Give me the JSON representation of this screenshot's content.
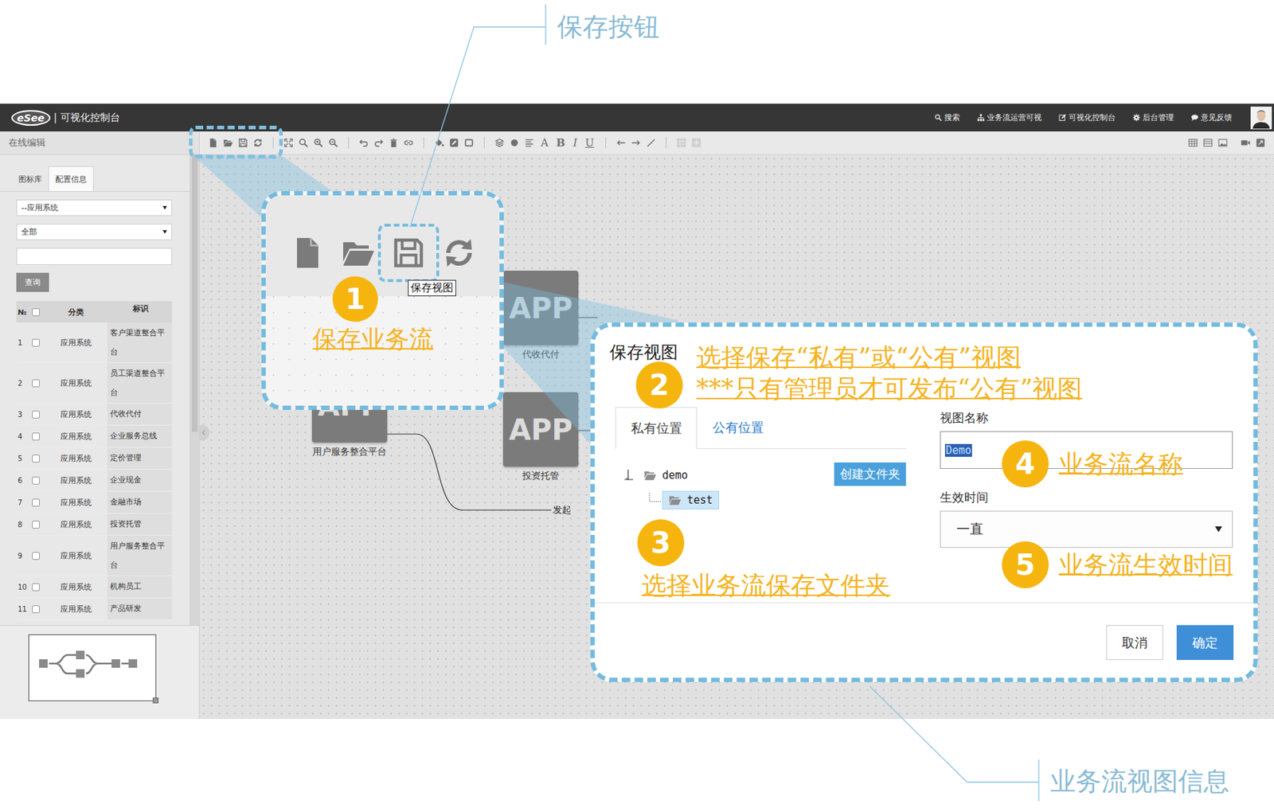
{
  "annotations": {
    "save_button_label": "保存按钮",
    "view_info_label": "业务流视图信息"
  },
  "topbar": {
    "logo": "eSee",
    "title": "| 可视化控制台",
    "nav": [
      {
        "label": "搜索"
      },
      {
        "label": "业务流运营可视"
      },
      {
        "label": "可视化控制台"
      },
      {
        "label": "后台管理"
      },
      {
        "label": "意见反馈"
      }
    ]
  },
  "left_panel": {
    "header": "在线编辑",
    "tabs": [
      {
        "label": "图标库",
        "selected": false
      },
      {
        "label": "配置信息",
        "selected": true
      }
    ],
    "filters": [
      "--应用系统",
      "全部"
    ],
    "search_input": "",
    "query_button": "查询",
    "table": {
      "columns": [
        "№",
        "分类",
        "标识"
      ],
      "header_checked": false,
      "rows": [
        {
          "no": "1",
          "category": "应用系统",
          "name": "客户渠道整合平台",
          "checked": false
        },
        {
          "no": "2",
          "category": "应用系统",
          "name": "员工渠道整合平台",
          "checked": false
        },
        {
          "no": "3",
          "category": "应用系统",
          "name": "代收代付",
          "checked": false
        },
        {
          "no": "4",
          "category": "应用系统",
          "name": "企业服务总线",
          "checked": false
        },
        {
          "no": "5",
          "category": "应用系统",
          "name": "定价管理",
          "checked": false
        },
        {
          "no": "6",
          "category": "应用系统",
          "name": "企业现金",
          "checked": false
        },
        {
          "no": "7",
          "category": "应用系统",
          "name": "金融市场",
          "checked": false
        },
        {
          "no": "8",
          "category": "应用系统",
          "name": "投资托管",
          "checked": false
        },
        {
          "no": "9",
          "category": "应用系统",
          "name": "用户服务整合平台",
          "checked": false
        },
        {
          "no": "10",
          "category": "应用系统",
          "name": "机构员工",
          "checked": false
        },
        {
          "no": "11",
          "category": "应用系统",
          "name": "产品研发",
          "checked": false
        }
      ]
    }
  },
  "toolbar": {
    "format_buttons": [
      {
        "label": "A",
        "kind": "plain"
      },
      {
        "label": "B",
        "kind": "bold"
      },
      {
        "label": "I",
        "kind": "italic"
      },
      {
        "label": "U",
        "kind": "underline"
      }
    ]
  },
  "canvas": {
    "nodes": [
      {
        "icon_text": "APP",
        "label": "代收代付"
      },
      {
        "icon_text": "APP",
        "label": "投资托管"
      },
      {
        "icon_text": "APP",
        "label": "用户服务整合平台"
      }
    ],
    "edge_label": "发起"
  },
  "callout_save": {
    "number": "1",
    "text": "保存业务流",
    "tooltip": "保存视图"
  },
  "dialog": {
    "title": "保存视图",
    "tabs": [
      {
        "label": "私有位置",
        "selected": true
      },
      {
        "label": "公有位置",
        "selected": false
      }
    ],
    "tree": [
      {
        "label": "demo",
        "depth": 0,
        "selected": false
      },
      {
        "label": "test",
        "depth": 1,
        "selected": true
      }
    ],
    "create_folder_button": "创建文件夹",
    "fields": [
      {
        "label": "视图名称",
        "kind": "input",
        "value": "Demo",
        "text_selected": true
      },
      {
        "label": "生效时间",
        "kind": "select",
        "value": "一直",
        "text_selected": false
      }
    ],
    "buttons": [
      {
        "label": "取消",
        "primary": false
      },
      {
        "label": "确定",
        "primary": true
      }
    ]
  },
  "steps": [
    {
      "number": "2",
      "lines": [
        "选择保存“私有”或“公有”视图",
        "***只有管理员才可发布“公有”视图"
      ]
    },
    {
      "number": "3",
      "lines": [
        "选择业务流保存文件夹"
      ]
    },
    {
      "number": "4",
      "lines": [
        "业务流名称"
      ]
    },
    {
      "number": "5",
      "lines": [
        "业务流生效时间"
      ]
    }
  ]
}
